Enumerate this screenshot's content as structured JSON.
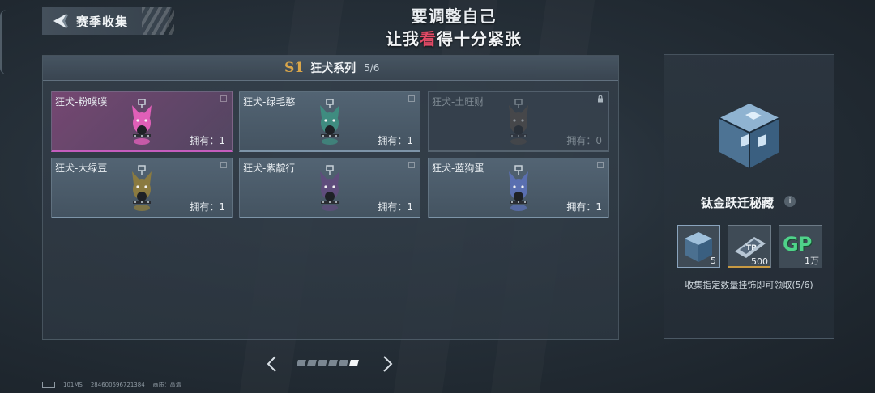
{
  "header": {
    "back_title": "赛季收集",
    "subtitle_line1": "要调整自己",
    "subtitle_line2_part1": "让我",
    "subtitle_line2_highlight": "看",
    "subtitle_line2_part2": "得十分紧张"
  },
  "series": {
    "badge": "S1",
    "name": "狂犬系列",
    "progress": "5/6"
  },
  "cards": [
    {
      "name": "狂犬-粉噗噗",
      "owned": "拥有：1",
      "style": "pink",
      "color": "#e05fb8"
    },
    {
      "name": "狂犬-绿毛憨",
      "owned": "拥有：1",
      "style": "normal",
      "color": "#3f8c80"
    },
    {
      "name": "狂犬-土旺财",
      "owned": "拥有：0",
      "style": "locked",
      "color": "#5b5148"
    },
    {
      "name": "狂犬-大绿豆",
      "owned": "拥有：1",
      "style": "normal",
      "color": "#8a7a40"
    },
    {
      "name": "狂犬-紫靛行",
      "owned": "拥有：1",
      "style": "normal",
      "color": "#5f4d7c"
    },
    {
      "name": "狂犬-蓝狗蛋",
      "owned": "拥有：1",
      "style": "normal",
      "color": "#5a6fb0"
    }
  ],
  "pagination": {
    "pages": 6,
    "current": 6
  },
  "reward": {
    "title": "钛金跃迁秘藏",
    "items": [
      {
        "icon": "cube-icon",
        "qty": "5",
        "selected": true,
        "accent": "#7f98ad"
      },
      {
        "icon": "ticket-icon",
        "qty": "500",
        "selected": false,
        "accent": "#c89a43"
      },
      {
        "icon": "gp-icon",
        "label": "GP",
        "qty": "1万",
        "selected": false,
        "accent": "#8a98a4"
      }
    ],
    "description": "收集指定数量挂饰即可领取(5/6)"
  },
  "footer": {
    "ping": "101MS",
    "uid": "284600596721384",
    "quality": "画质：高清"
  }
}
